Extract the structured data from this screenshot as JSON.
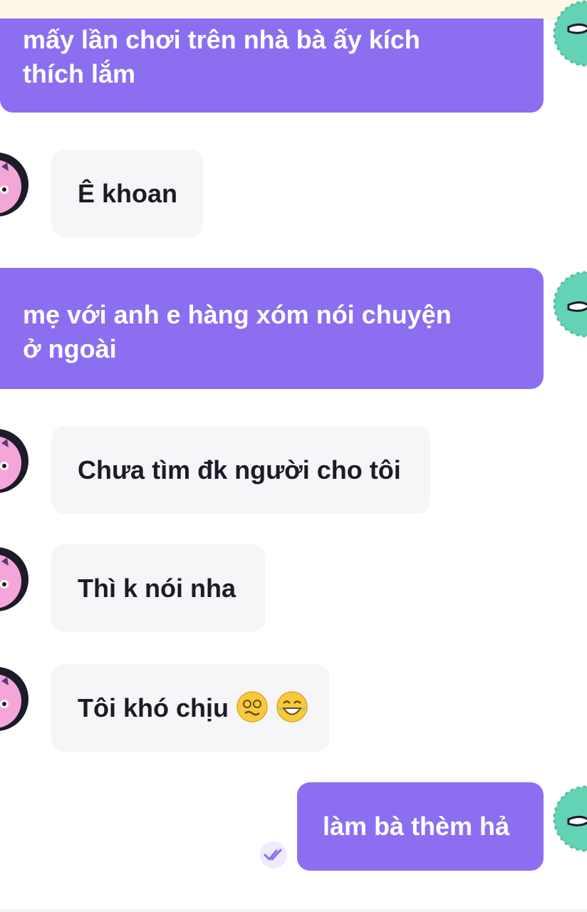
{
  "top_banner": {
    "text": ""
  },
  "messages": [
    {
      "side": "sent",
      "lines": [
        "mấy lần chơi trên nhà bà ấy kích",
        "thích lắm"
      ]
    },
    {
      "side": "received",
      "text": "Ê khoan"
    },
    {
      "side": "sent",
      "lines": [
        "mẹ với anh e hàng xóm nói chuyện",
        "ở ngoài"
      ]
    },
    {
      "side": "received",
      "text": "Chưa tìm đk người cho tôi"
    },
    {
      "side": "received",
      "text": "Thì k nói nha"
    },
    {
      "side": "received",
      "text": "Tôi khó chịu",
      "emojis": [
        "woozy-face-emoji",
        "grinning-sweat-emoji"
      ]
    },
    {
      "side": "sent",
      "text": "làm bà thèm hả",
      "status_icon": "double-check-icon"
    }
  ],
  "colors": {
    "sent_bubble": "#8c6ef0",
    "received_bubble": "#f6f6f8",
    "received_text": "#1c1c28",
    "avatar_left": "#f4a6d8",
    "avatar_right": "#64d2b4"
  },
  "icons": {
    "left_avatar": "pink-monster-avatar",
    "right_avatar": "green-monster-avatar",
    "read_status": "double-check-icon"
  }
}
